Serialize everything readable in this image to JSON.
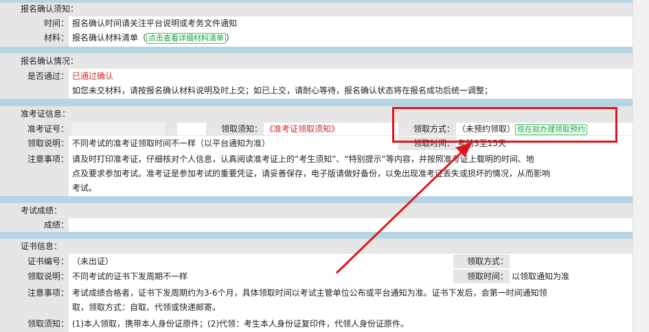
{
  "signup_confirm_notice": {
    "title": "报名确认须知：",
    "time_label": "时间：",
    "time_value": "报名确认时间请关注平台说明或考务文件通知",
    "material_label": "材料：",
    "material_prefix": "报名确认材料清单（",
    "material_button": "点击查看详细材料清单",
    "material_suffix": "）"
  },
  "signup_confirm_status": {
    "title": "报名确认情况：",
    "passed_label": "是否通过：",
    "passed_value": "已通过确认",
    "note": "如您未交材料，请按报名确认材料说明及时上交；如已上交，请耐心等待，报名确认状态将在报名成功后统一调整；"
  },
  "admission_ticket": {
    "title": "准考证信息：",
    "number_label": "准考证号：",
    "notice_label": "领取须知：",
    "notice_open": "《",
    "notice_link": "准考证领取须知",
    "notice_close": "》",
    "method_label": "领取方式：",
    "method_value": "（未预约领取）",
    "method_button": "现在就办理领取预约",
    "desc_label": "领取说明：",
    "desc_value": "不同考试的准考证领取时间不一样（以平台通知为准）",
    "time_label": "领取时间：",
    "time_value": "考前3至15天",
    "attention_label": "注意事项：",
    "attention_lines": [
      "请及时打印准考证，仔细核对个人信息，认真阅读准考证上的“考生须知”、“特别提示”等内容，并按照准考证上载明的时间、地",
      "点及要求参加考试。准考证是参加考试的重要凭证，请妥善保存，电子版请做好备份，以免出现准考证丢失或损坏的情况，从而影响",
      "考试。"
    ]
  },
  "exam_scores": {
    "title": "考试成绩：",
    "score_label": "成绩："
  },
  "certificate": {
    "title": "证书信息：",
    "number_label": "证书编号：",
    "number_value": "（未出证）",
    "method_label": "领取方式：",
    "desc_label": "领取说明：",
    "desc_value": "不同考试的证书下发周期不一样",
    "time_label": "领取时间：",
    "time_value": "以领取通知为准",
    "attention_label": "注意事项：",
    "attention_lines": [
      "考试成绩合格者，证书下发周期约为3-6个月，具体领取时间以考试主管单位公布或平台通知为准。证书下发后，会第一时间通知领",
      "取，领取方式：自取、代领或快递邮寄。"
    ],
    "notice_label": "领取须知：",
    "notice_value": "(1)本人领取，携带本人身份证原件；(2)代领：考生本人身份证复印件，代领人身份证原件。"
  },
  "colors": {
    "band": "#b7d4e4",
    "label_bg": "#e6e6e6",
    "highlight_red": "#e0141e",
    "button_green": "#23a04a"
  }
}
